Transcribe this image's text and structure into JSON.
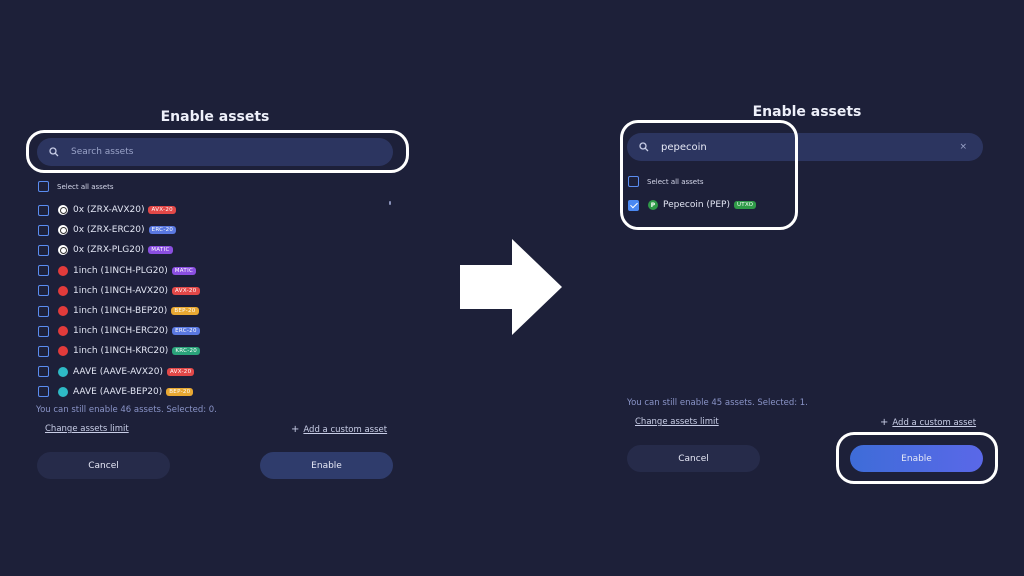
{
  "left": {
    "title": "Enable assets",
    "search_placeholder": "Search assets",
    "select_all": "Select all assets",
    "assets": [
      {
        "label": "0x (ZRX-AVX20)",
        "icon": "zrx-icon",
        "badge": "AVX-20",
        "badge_color": "#e24848"
      },
      {
        "label": "0x (ZRX-ERC20)",
        "icon": "zrx-icon",
        "badge": "ERC-20",
        "badge_color": "#5a78e0"
      },
      {
        "label": "0x (ZRX-PLG20)",
        "icon": "zrx-icon",
        "badge": "MATIC",
        "badge_color": "#8a4fe0"
      },
      {
        "label": "1inch (1INCH-PLG20)",
        "icon": "1inch-icon",
        "badge": "MATIC",
        "badge_color": "#8a4fe0"
      },
      {
        "label": "1inch (1INCH-AVX20)",
        "icon": "1inch-icon",
        "badge": "AVX-20",
        "badge_color": "#e24848"
      },
      {
        "label": "1inch (1INCH-BEP20)",
        "icon": "1inch-icon",
        "badge": "BEP-20",
        "badge_color": "#e8a832"
      },
      {
        "label": "1inch (1INCH-ERC20)",
        "icon": "1inch-icon",
        "badge": "ERC-20",
        "badge_color": "#5a78e0"
      },
      {
        "label": "1inch (1INCH-KRC20)",
        "icon": "1inch-icon",
        "badge": "KRC-20",
        "badge_color": "#2aa37a"
      },
      {
        "label": "AAVE (AAVE-AVX20)",
        "icon": "aave-icon",
        "badge": "AVX-20",
        "badge_color": "#e24848"
      },
      {
        "label": "AAVE (AAVE-BEP20)",
        "icon": "aave-icon",
        "badge": "BEP-20",
        "badge_color": "#e8a832"
      }
    ],
    "info": "You can still enable 46 assets. Selected: 0.",
    "change_limit": "Change assets limit",
    "add_custom": "Add a custom asset",
    "cancel": "Cancel",
    "enable": "Enable"
  },
  "right": {
    "title": "Enable assets",
    "search_value": "pepecoin",
    "clear": "×",
    "select_all": "Select all assets",
    "asset": {
      "label": "Pepecoin (PEP)",
      "icon": "pepecoin-icon",
      "icon_letter": "P",
      "badge": "UTXO",
      "badge_color": "#2f9a48",
      "checked": true
    },
    "info": "You can still enable 45 assets. Selected: 1.",
    "change_limit": "Change assets limit",
    "add_custom": "Add a custom asset",
    "cancel": "Cancel",
    "enable": "Enable"
  },
  "colors": {
    "background": "#1d2039",
    "search_bg": "#2c3560",
    "accent": "#4a88f2",
    "enable_active": "#4f6ae0"
  }
}
